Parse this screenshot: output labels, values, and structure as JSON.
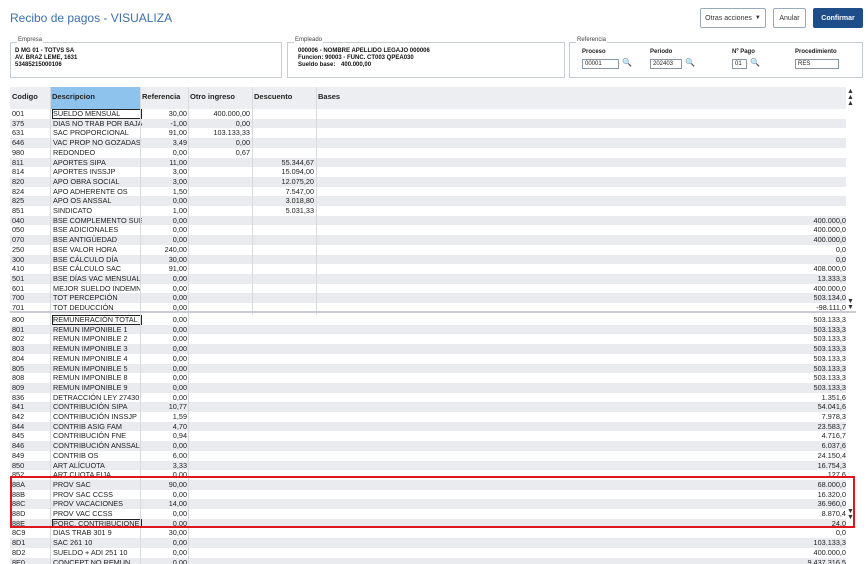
{
  "header": {
    "title": "Recibo de pagos - VISUALIZA",
    "other_actions": "Otras acciones",
    "cancel": "Anular",
    "confirm": "Confirmar"
  },
  "empresa": {
    "label": "Empresa",
    "line1": "D MG 01 - TOTVS SA",
    "line2": "AV. BRAZ LEME, 1631",
    "line3": "53485215000106"
  },
  "empleado": {
    "label": "Empleado",
    "line1": "000006 - NOMBRE APELLIDO LEGAJO 000006",
    "line2": "Funcion: 90003 - FUNC. CT003 QPEA030",
    "line3_label": "Sueldo base:",
    "line3_value": "400.000,00"
  },
  "referencia": {
    "label": "Referencia",
    "proceso_label": "Proceso",
    "proceso_value": "00001",
    "periodo_label": "Periodo",
    "periodo_value": "202403",
    "npago_label": "Nº Pago",
    "npago_value": "01",
    "procedimiento_label": "Procedimiento",
    "procedimiento_value": "RES"
  },
  "grid": {
    "columns": [
      "Codigo",
      "Descripcion",
      "Referencia",
      "Otro ingreso",
      "Descuento",
      "Bases"
    ],
    "rows_top": [
      {
        "code": "001",
        "desc": "SUELDO MENSUAL",
        "ref": "30,00",
        "otro": "400.000,00",
        "descu": "",
        "bases": ""
      },
      {
        "code": "375",
        "desc": "DIAS NO TRAB POR BAJA",
        "ref": "-1,00",
        "otro": "0,00",
        "descu": "",
        "bases": ""
      },
      {
        "code": "631",
        "desc": "SAC PROPORCIONAL",
        "ref": "91,00",
        "otro": "103.133,33",
        "descu": "",
        "bases": ""
      },
      {
        "code": "646",
        "desc": "VAC PROP NO GOZADAS",
        "ref": "3,49",
        "otro": "0,00",
        "descu": "",
        "bases": ""
      },
      {
        "code": "980",
        "desc": "REDONDEO",
        "ref": "0,00",
        "otro": "0,67",
        "descu": "",
        "bases": ""
      },
      {
        "code": "811",
        "desc": "APORTES SIPA",
        "ref": "11,00",
        "otro": "",
        "descu": "55.344,67",
        "bases": ""
      },
      {
        "code": "814",
        "desc": "APORTES INSSJP",
        "ref": "3,00",
        "otro": "",
        "descu": "15.094,00",
        "bases": ""
      },
      {
        "code": "820",
        "desc": "APO OBRA SOCIAL",
        "ref": "3,00",
        "otro": "",
        "descu": "12.075,20",
        "bases": ""
      },
      {
        "code": "824",
        "desc": "APO ADHERENTE OS",
        "ref": "1,50",
        "otro": "",
        "descu": "7.547,00",
        "bases": ""
      },
      {
        "code": "825",
        "desc": "APO OS ANSSAL",
        "ref": "0,00",
        "otro": "",
        "descu": "3.018,80",
        "bases": ""
      },
      {
        "code": "851",
        "desc": "SINDICATO",
        "ref": "1,00",
        "otro": "",
        "descu": "5.031,33",
        "bases": ""
      },
      {
        "code": "040",
        "desc": "BSE COMPLEMENTO SUELDO",
        "ref": "0,00",
        "otro": "",
        "descu": "",
        "bases": "400.000,0"
      },
      {
        "code": "050",
        "desc": "BSE ADICIONALES",
        "ref": "0,00",
        "otro": "",
        "descu": "",
        "bases": "400.000,0"
      },
      {
        "code": "070",
        "desc": "BSE ANTIGÜEDAD",
        "ref": "0,00",
        "otro": "",
        "descu": "",
        "bases": "400.000,0"
      },
      {
        "code": "250",
        "desc": "BSE VALOR HORA",
        "ref": "240,00",
        "otro": "",
        "descu": "",
        "bases": "0,0"
      },
      {
        "code": "300",
        "desc": "BSE CÁLCULO DÍA",
        "ref": "30,00",
        "otro": "",
        "descu": "",
        "bases": "0,0"
      },
      {
        "code": "410",
        "desc": "BSE CÁLCULO SAC",
        "ref": "91,00",
        "otro": "",
        "descu": "",
        "bases": "408.000,0"
      },
      {
        "code": "501",
        "desc": "BSE DÍAS VAC MENSUAL",
        "ref": "0,00",
        "otro": "",
        "descu": "",
        "bases": "13.333,3"
      },
      {
        "code": "601",
        "desc": "MEJOR SUELDO INDEMN",
        "ref": "0,00",
        "otro": "",
        "descu": "",
        "bases": "400.000,0"
      },
      {
        "code": "700",
        "desc": "TOT PERCEPCIÓN",
        "ref": "0,00",
        "otro": "",
        "descu": "",
        "bases": "503.134,0"
      },
      {
        "code": "701",
        "desc": "TOT DEDUCCIÓN",
        "ref": "0,00",
        "otro": "",
        "descu": "",
        "bases": "-98.111,0"
      }
    ],
    "rows_bottom": [
      {
        "code": "800",
        "desc": "REMUNERACIÓN TOTAL",
        "ref": "0,00",
        "bases": "503.133,3"
      },
      {
        "code": "801",
        "desc": "REMUN IMPONIBLE 1",
        "ref": "0,00",
        "bases": "503.133,3"
      },
      {
        "code": "802",
        "desc": "REMUN IMPONIBLE 2",
        "ref": "0,00",
        "bases": "503.133,3"
      },
      {
        "code": "803",
        "desc": "REMUN IMPONIBLE 3",
        "ref": "0,00",
        "bases": "503.133,3"
      },
      {
        "code": "804",
        "desc": "REMUN IMPONIBLE 4",
        "ref": "0,00",
        "bases": "503.133,3"
      },
      {
        "code": "805",
        "desc": "REMUN IMPONIBLE 5",
        "ref": "0,00",
        "bases": "503.133,3"
      },
      {
        "code": "808",
        "desc": "REMUN IMPONIBLE 8",
        "ref": "0,00",
        "bases": "503.133,3"
      },
      {
        "code": "809",
        "desc": "REMUN IMPONIBLE 9",
        "ref": "0,00",
        "bases": "503.133,3"
      },
      {
        "code": "836",
        "desc": "DETRACCIÓN LEY 27430",
        "ref": "0,00",
        "bases": "1.351,6"
      },
      {
        "code": "841",
        "desc": "CONTRIBUCIÓN SIPA",
        "ref": "10,77",
        "bases": "54.041,6"
      },
      {
        "code": "842",
        "desc": "CONTRIBUCIÓN INSSJP",
        "ref": "1,59",
        "bases": "7.978,3"
      },
      {
        "code": "844",
        "desc": "CONTRIB ASIG FAM",
        "ref": "4,70",
        "bases": "23.583,7"
      },
      {
        "code": "845",
        "desc": "CONTRIBUCIÓN FNE",
        "ref": "0,94",
        "bases": "4.716,7"
      },
      {
        "code": "846",
        "desc": "CONTRIBUCIÓN ANSSAL",
        "ref": "0,00",
        "bases": "6.037,6"
      },
      {
        "code": "849",
        "desc": "CONTRIB OS",
        "ref": "6,00",
        "bases": "24.150,4"
      },
      {
        "code": "850",
        "desc": "ART ALÍCUOTA",
        "ref": "3,33",
        "bases": "16.754,3"
      },
      {
        "code": "852",
        "desc": "ART CUOTA FIJA",
        "ref": "0,00",
        "bases": "127,6"
      },
      {
        "code": "88A",
        "desc": "PROV SAC",
        "ref": "90,00",
        "bases": "68.000,0"
      },
      {
        "code": "88B",
        "desc": "PROV SAC CCSS",
        "ref": "0,00",
        "bases": "16.320,0"
      },
      {
        "code": "88C",
        "desc": "PROV VACACIONES",
        "ref": "14,00",
        "bases": "36.960,0"
      },
      {
        "code": "88D",
        "desc": "PROV VAC CCSS",
        "ref": "0,00",
        "bases": "8.870,4"
      },
      {
        "code": "88E",
        "desc": "PORC. CONTRIBUCIONES",
        "ref": "0,00",
        "bases": "24,0"
      },
      {
        "code": "8C9",
        "desc": "DIAS TRAB 301 9",
        "ref": "30,00",
        "bases": "0,0"
      },
      {
        "code": "8D1",
        "desc": "SAC 261 10",
        "ref": "0,00",
        "bases": "103.133,3"
      },
      {
        "code": "8D2",
        "desc": "SUELDO + ADI 251 10",
        "ref": "0,00",
        "bases": "400.000,0"
      },
      {
        "code": "8E0",
        "desc": "CONCEPT NO REMUN",
        "ref": "0,00",
        "bases": "9.437.316,5"
      }
    ]
  }
}
